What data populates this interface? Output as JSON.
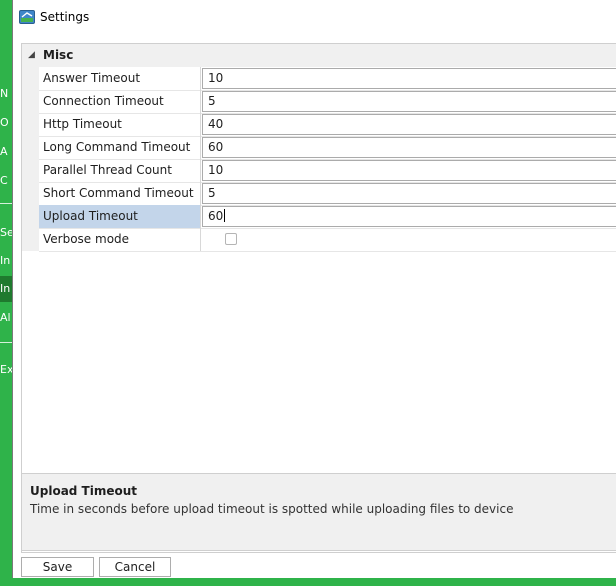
{
  "window": {
    "title": "Settings"
  },
  "background_app": {
    "letters": [
      "N",
      "O",
      "A",
      "C",
      "Se",
      "In",
      "In",
      "Al",
      "Ex"
    ]
  },
  "property_grid": {
    "category": "Misc",
    "properties": [
      {
        "name": "Answer Timeout",
        "value": "10"
      },
      {
        "name": "Connection Timeout",
        "value": "5"
      },
      {
        "name": "Http Timeout",
        "value": "40"
      },
      {
        "name": "Long Command Timeout",
        "value": "60"
      },
      {
        "name": "Parallel Thread Count",
        "value": "10"
      },
      {
        "name": "Short Command Timeout",
        "value": "5"
      },
      {
        "name": "Upload Timeout",
        "value": "60"
      },
      {
        "name": "Verbose mode",
        "value": "false"
      }
    ],
    "selected": "Upload Timeout"
  },
  "description": {
    "title": "Upload Timeout",
    "text": "Time in seconds before upload timeout is spotted while uploading files to device"
  },
  "buttons": {
    "save": "Save",
    "cancel": "Cancel"
  },
  "colors": {
    "accent_green": "#2fb34a",
    "selection": "#c3d5ea"
  }
}
